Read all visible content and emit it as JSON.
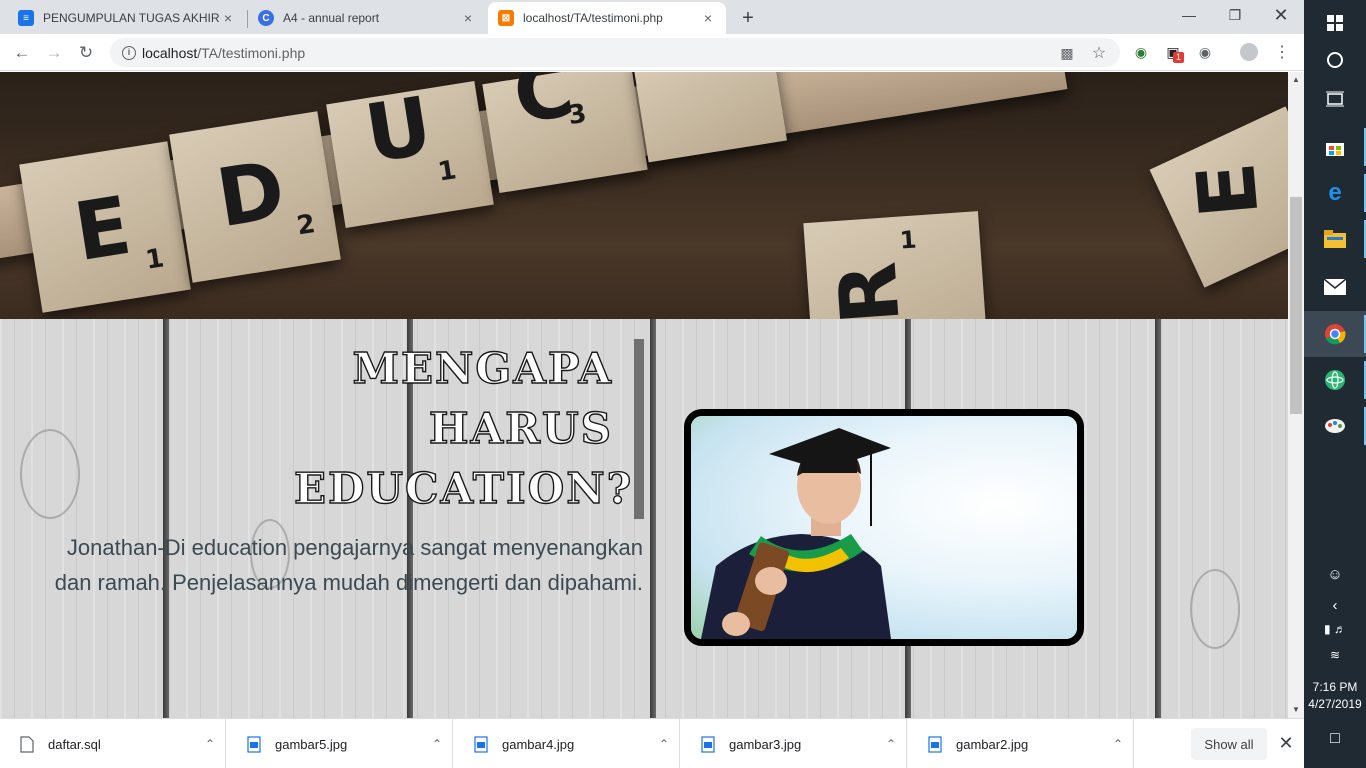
{
  "browser": {
    "tabs": [
      {
        "title": "PENGUMPULAN TUGAS AKHIR W",
        "favicon": "google-forms-icon",
        "color": "#1a73e8"
      },
      {
        "title": "A4 - annual report",
        "favicon": "canva-icon",
        "color": "#3b6fe6"
      },
      {
        "title": "localhost/TA/testimoni.php",
        "favicon": "xampp-icon",
        "color": "#f57c00"
      }
    ],
    "close_glyph": "×",
    "new_tab_glyph": "+",
    "url_host": "localhost",
    "url_path": "/TA/testimoni.php",
    "extension_badge": "1"
  },
  "hero": {
    "tiles": [
      {
        "letter": "E",
        "number": "1"
      },
      {
        "letter": "D",
        "number": "2"
      },
      {
        "letter": "U",
        "number": "1"
      },
      {
        "letter": "C",
        "number": "3"
      },
      {
        "letter": "R",
        "number": "1"
      },
      {
        "letter": "E",
        "number": ""
      }
    ]
  },
  "section": {
    "heading_lines": [
      "MENGAPA",
      "HARUS",
      "EDUCATION?"
    ],
    "testimonial_lines": [
      "Jonathan-Di education pengajarnya sangat menyenangkan",
      "dan ramah. Penjelasannya mudah dimengerti dan dipahami."
    ],
    "image_alt": "graduation-student-photo"
  },
  "downloads": {
    "items": [
      {
        "name": "daftar.sql",
        "icon": "file-icon"
      },
      {
        "name": "gambar5.jpg",
        "icon": "image-file-icon"
      },
      {
        "name": "gambar4.jpg",
        "icon": "image-file-icon"
      },
      {
        "name": "gambar3.jpg",
        "icon": "image-file-icon"
      },
      {
        "name": "gambar2.jpg",
        "icon": "image-file-icon"
      }
    ],
    "show_all": "Show all"
  },
  "taskbar": {
    "time": "7:16 PM",
    "date": "4/27/2019"
  }
}
